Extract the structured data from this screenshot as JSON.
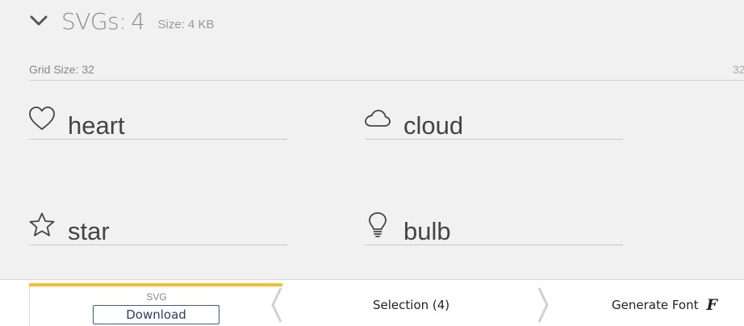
{
  "set": {
    "title": "SVGs:",
    "count": "4",
    "size": "Size: 4 KB"
  },
  "grid": {
    "label": "Grid Size: 32",
    "value_right": "32"
  },
  "glyphs": [
    {
      "name": "heart",
      "icon": "heart-icon"
    },
    {
      "name": "cloud",
      "icon": "cloud-icon"
    },
    {
      "name": "star",
      "icon": "star-icon"
    },
    {
      "name": "bulb",
      "icon": "bulb-icon"
    }
  ],
  "bottom_bar": {
    "download_type": "SVG",
    "download_label": "Download",
    "selection_label": "Selection (4)",
    "generate_font_label": "Generate Font",
    "generate_font_icon": "F",
    "accent_color": "#f6bf2f"
  }
}
